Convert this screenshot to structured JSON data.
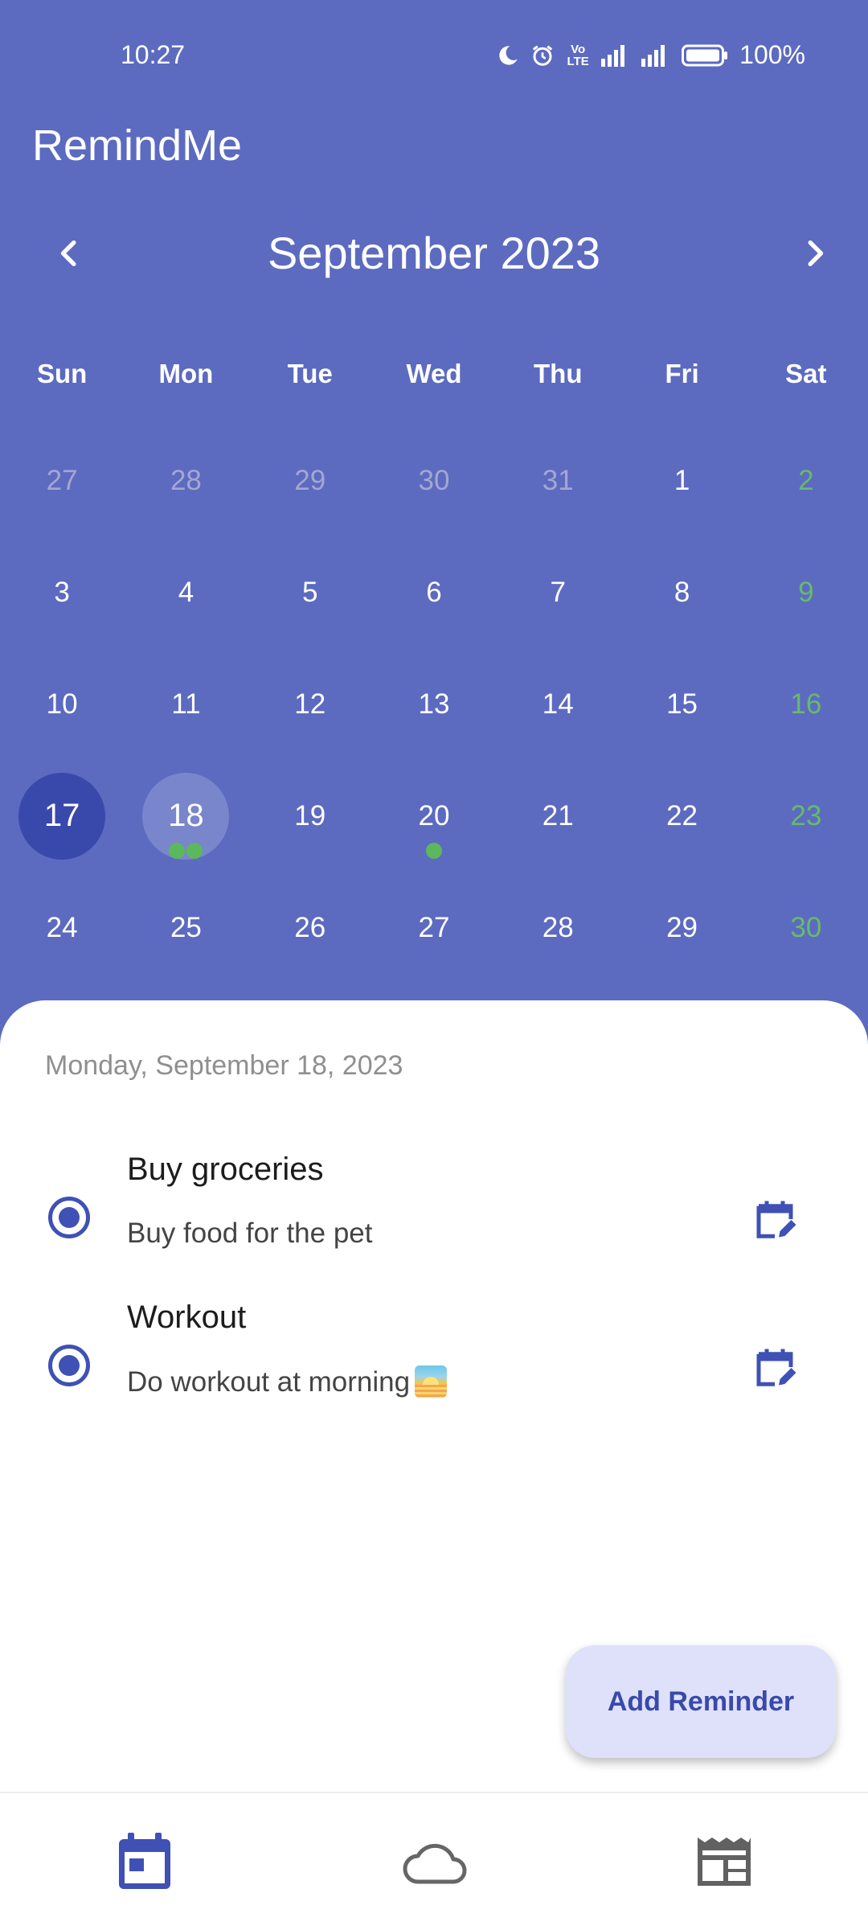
{
  "status_bar": {
    "time": "10:27",
    "battery_percent": "100%",
    "volte": "Vo LTE",
    "icons": [
      "moon-icon",
      "alarm-icon",
      "volte-icon",
      "signal-icon",
      "signal-icon",
      "battery-icon"
    ]
  },
  "app": {
    "title": "RemindMe"
  },
  "calendar": {
    "month_label": "September 2023",
    "prev_icon": "chevron-left-icon",
    "next_icon": "chevron-right-icon",
    "weekdays": [
      "Sun",
      "Mon",
      "Tue",
      "Wed",
      "Thu",
      "Fri",
      "Sat"
    ],
    "today": "17",
    "selected": "18",
    "weeks": [
      [
        "27",
        "28",
        "29",
        "30",
        "31",
        "1",
        "2"
      ],
      [
        "3",
        "4",
        "5",
        "6",
        "7",
        "8",
        "9"
      ],
      [
        "10",
        "11",
        "12",
        "13",
        "14",
        "15",
        "16"
      ],
      [
        "17",
        "18",
        "19",
        "20",
        "21",
        "22",
        "23"
      ],
      [
        "24",
        "25",
        "26",
        "27",
        "28",
        "29",
        "30"
      ]
    ],
    "event_dot_counts": {
      "18": 2,
      "20": 1
    }
  },
  "selected_date_label": "Monday, September 18, 2023",
  "reminders": [
    {
      "title": "Buy groceries",
      "description": "Buy food for the pet",
      "emoji": ""
    },
    {
      "title": "Workout",
      "description": "Do workout at morning",
      "emoji": "sunrise"
    }
  ],
  "fab": {
    "label": "Add Reminder"
  },
  "bottom_nav": {
    "items": [
      "calendar-icon",
      "cloud-icon",
      "newspaper-icon"
    ]
  },
  "colors": {
    "primary": "#5c6bc0",
    "accent": "#3f51b5",
    "today_circle": "#3949ab",
    "selected_circle": "#7986cb",
    "weekend": "#66bb6a",
    "fab_bg": "#dfe1fb"
  }
}
